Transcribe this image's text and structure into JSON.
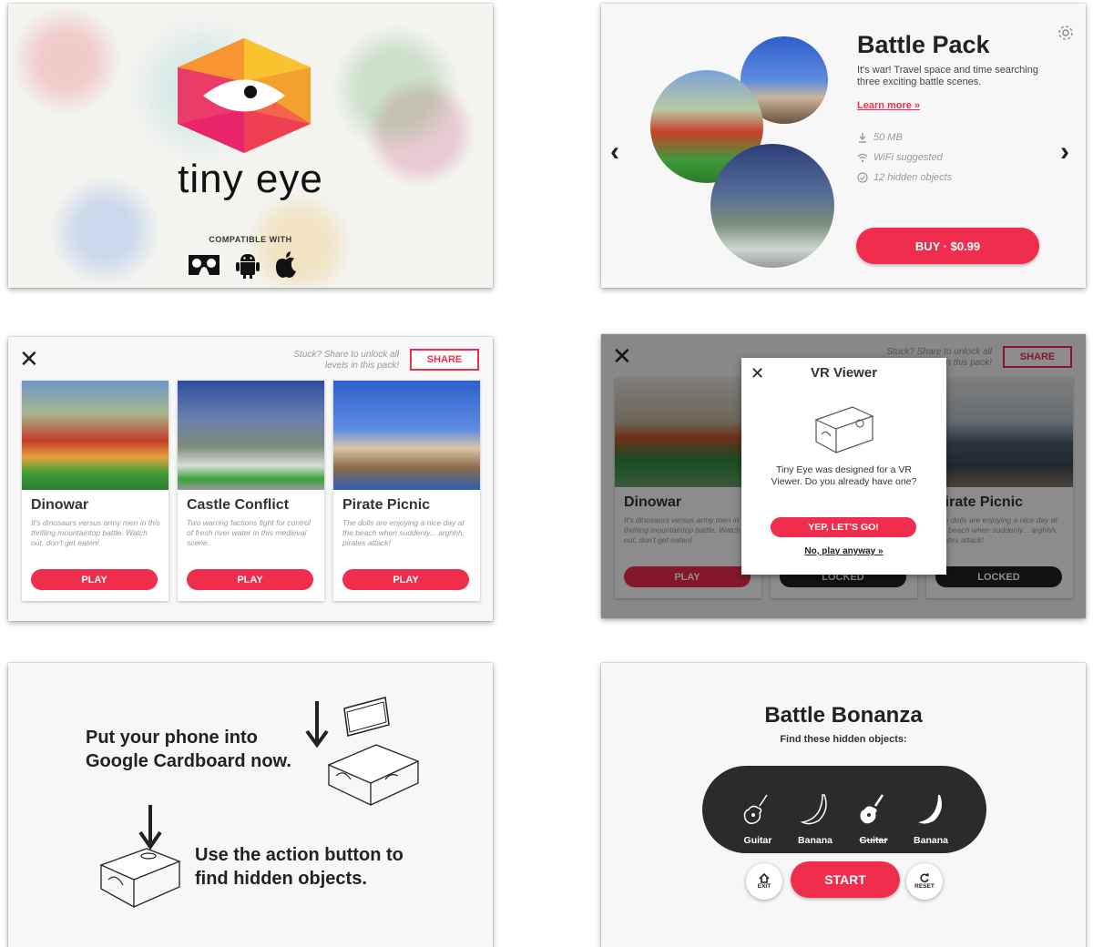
{
  "splash": {
    "app_name": "tiny eye",
    "compatible_label": "COMPATIBLE WITH",
    "platforms": [
      "cardboard-icon",
      "android-icon",
      "apple-icon"
    ]
  },
  "pack_detail": {
    "title": "Battle Pack",
    "description": "It's war! Travel space and time searching three exciting battle scenes.",
    "learn_more": "Learn more »",
    "size": "50 MB",
    "wifi": "WiFi suggested",
    "objects": "12 hidden objects",
    "buy_label": "BUY · $0.99"
  },
  "level_select": {
    "stuck_text": "Stuck? Share to unlock all levels in this pack!",
    "share_label": "SHARE",
    "levels": [
      {
        "title": "Dinowar",
        "desc": "It's dinosaurs versus army men in this thrilling mountaintop battle. Watch out, don't get eaten!",
        "button": "PLAY"
      },
      {
        "title": "Castle Conflict",
        "desc": "Two warring factions fight for control of fresh river water in this medieval scene.",
        "button": "PLAY"
      },
      {
        "title": "Pirate Picnic",
        "desc": "The dolls are enjoying a nice day at the beach when suddenly... arghhh, pirates attack!",
        "button": "PLAY"
      }
    ]
  },
  "vr_dialog": {
    "stuck_text": "Stuck? Share to unlock all levels in this pack!",
    "share_label": "SHARE",
    "levels": [
      {
        "title": "Dinowar",
        "desc": "It's dinosaurs versus army men in this thrilling mountaintop battle. Watch out, don't get eaten!",
        "button": "PLAY"
      },
      {
        "title": "",
        "desc": "",
        "button": "LOCKED"
      },
      {
        "title": "Pirate Picnic",
        "desc": "The dolls are enjoying a nice day at the beach when suddenly... arghhh, pirates attack!",
        "button": "LOCKED"
      }
    ],
    "title": "VR Viewer",
    "message": "Tiny Eye was designed for a VR Viewer. Do you already have one?",
    "yes_label": "YEP, LET'S GO!",
    "no_label": "No, play anyway »"
  },
  "instructions": {
    "step1": "Put your phone into Google Cardboard now.",
    "step2": "Use the action button to find hidden objects."
  },
  "game_start": {
    "title": "Battle Bonanza",
    "subtitle": "Find these hidden objects:",
    "objects": [
      {
        "label": "Guitar",
        "icon": "guitar-icon",
        "found": false
      },
      {
        "label": "Banana",
        "icon": "banana-icon",
        "found": false
      },
      {
        "label": "Guitar",
        "icon": "guitar-icon",
        "found": true
      },
      {
        "label": "Banana",
        "icon": "banana-icon",
        "found": true
      }
    ],
    "exit_label": "EXIT",
    "start_label": "START",
    "reset_label": "RESET",
    "accent": "#f12d4d"
  }
}
